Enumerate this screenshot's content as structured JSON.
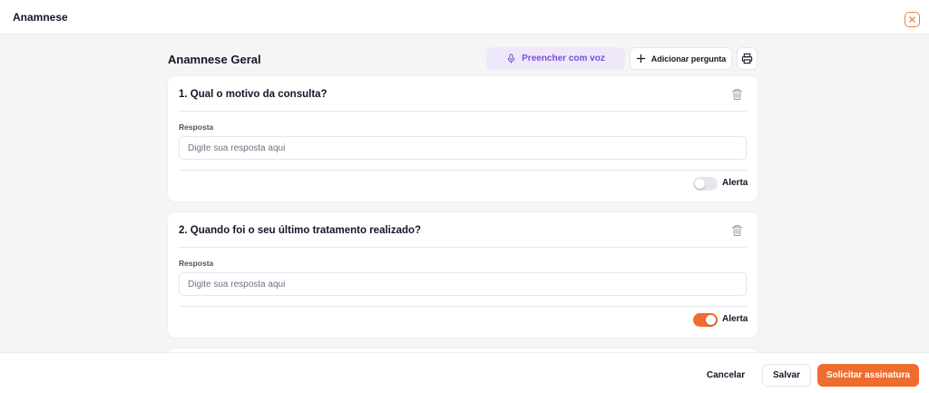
{
  "header": {
    "title": "Anamnese"
  },
  "section": {
    "title": "Anamnese Geral"
  },
  "toolbar": {
    "voice_label": "Preencher com voz",
    "add_label": "Adicionar pergunta"
  },
  "questions": [
    {
      "title": "1. Qual o motivo da consulta?",
      "answer_label": "Resposta",
      "answer_value": "",
      "answer_placeholder": "Digite sua resposta aqui",
      "alert_label": "Alerta",
      "alert_on": false
    },
    {
      "title": "2. Quando foi o seu último tratamento realizado?",
      "answer_label": "Resposta",
      "answer_value": "",
      "answer_placeholder": "Digite sua resposta aqui",
      "alert_label": "Alerta",
      "alert_on": true
    }
  ],
  "footer": {
    "cancel_label": "Cancelar",
    "save_label": "Salvar",
    "sign_label": "Solicitar assinatura"
  },
  "colors": {
    "accent": "#ef6c2f",
    "voice_bg": "#efe8fb",
    "voice_text": "#7c4ddb"
  },
  "icons": {
    "close": "close-icon",
    "microphone": "microphone-icon",
    "plus": "plus-icon",
    "print": "printer-icon",
    "trash": "trash-icon"
  }
}
